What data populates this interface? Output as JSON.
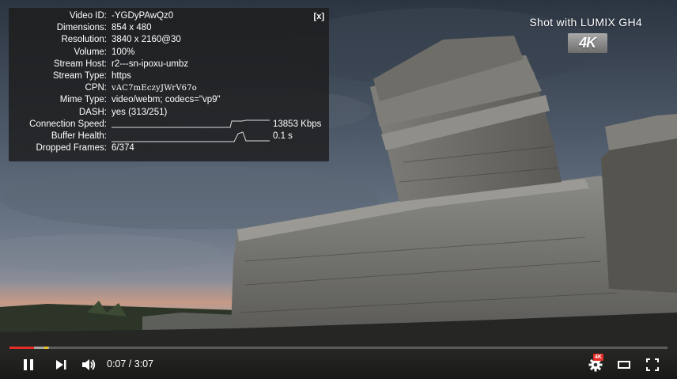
{
  "stats": {
    "close_label": "[x]",
    "rows": [
      {
        "key": "Video ID:",
        "value": "-YGDyPAwQz0"
      },
      {
        "key": "Dimensions:",
        "value": "854 x 480"
      },
      {
        "key": "Resolution:",
        "value": "3840 x 2160@30"
      },
      {
        "key": "Volume:",
        "value": "100%"
      },
      {
        "key": "Stream Host:",
        "value": "r2---sn-ipoxu-umbz"
      },
      {
        "key": "Stream Type:",
        "value": "https"
      },
      {
        "key": "CPN:",
        "value": "vAC7mEczyJWrV67o"
      },
      {
        "key": "Mime Type:",
        "value": "video/webm; codecs=\"vp9\""
      },
      {
        "key": "DASH:",
        "value": "yes (313/251)"
      }
    ],
    "connection_speed": {
      "key": "Connection Speed:",
      "value": "13853 Kbps"
    },
    "buffer_health": {
      "key": "Buffer Health:",
      "value": "0.1 s"
    },
    "dropped_frames": {
      "key": "Dropped Frames:",
      "value": "6/374"
    }
  },
  "watermark": {
    "shot_with": "Shot with LUMIX GH4",
    "badge": "4K"
  },
  "player": {
    "current_time": "0:07",
    "duration": "3:07",
    "time_display": "0:07 / 3:07",
    "played_fraction": 0.037,
    "buffered_fraction": 0.06,
    "quality_badge": "4K",
    "colors": {
      "progress": "#e52d27",
      "ad_marker": "#e8c01f"
    }
  },
  "icons": {
    "pause": "pause-icon",
    "next": "next-icon",
    "volume": "volume-icon",
    "settings": "gear-icon",
    "theater": "theater-mode-icon",
    "fullscreen": "fullscreen-icon"
  }
}
